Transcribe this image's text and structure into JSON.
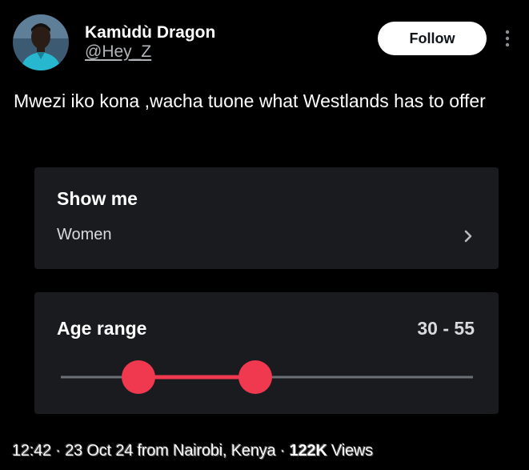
{
  "author": {
    "display_name": "Kamùdù Dragon",
    "handle": "@Hey_Z"
  },
  "follow_button": {
    "label": "Follow"
  },
  "tweet": {
    "text": "Mwezi iko kona ,wacha tuone what Westlands has to offer"
  },
  "show_me_card": {
    "title": "Show me",
    "value": "Women"
  },
  "age_range_card": {
    "title": "Age range",
    "value": "30 - 55",
    "slider": {
      "min_value": 30,
      "max_value": 55
    }
  },
  "meta": {
    "time": "12:42",
    "separator": "·",
    "date": "23 Oct 24",
    "location": "from Nairobi, Kenya",
    "views_count": "122K",
    "views_label": "Views"
  },
  "colors": {
    "background": "#000000",
    "card_background": "#1a1b1f",
    "slider_accent": "#f0384f",
    "slider_track": "#6b6f76",
    "follow_button_bg": "#ffffff"
  },
  "icons": {
    "more": "more-vertical-icon",
    "chevron": "chevron-right-icon"
  }
}
